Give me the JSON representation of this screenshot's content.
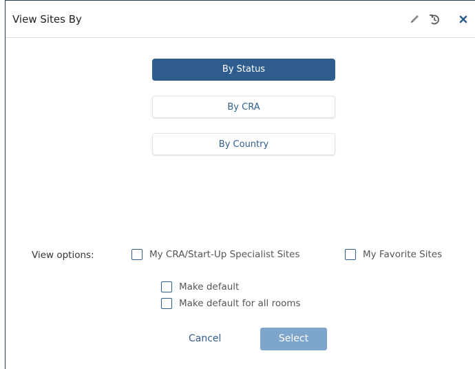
{
  "dialog": {
    "title": "View Sites By",
    "icons": {
      "edit": "pencil-icon",
      "reset": "undo-icon",
      "close": "close-icon"
    }
  },
  "group_options": [
    {
      "label": "By Status",
      "selected": true
    },
    {
      "label": "By CRA",
      "selected": false
    },
    {
      "label": "By Country",
      "selected": false
    }
  ],
  "view_options": {
    "label": "View options:",
    "checkboxes": [
      {
        "label": "My CRA/Start-Up Specialist Sites",
        "checked": false
      },
      {
        "label": "My Favorite Sites",
        "checked": false
      }
    ]
  },
  "defaults": {
    "make_default": "Make default",
    "make_default_all": "Make default for all rooms"
  },
  "footer": {
    "cancel": "Cancel",
    "select": "Select"
  },
  "colors": {
    "accent": "#2f5d8e",
    "select_button": "#7ea5cc"
  }
}
